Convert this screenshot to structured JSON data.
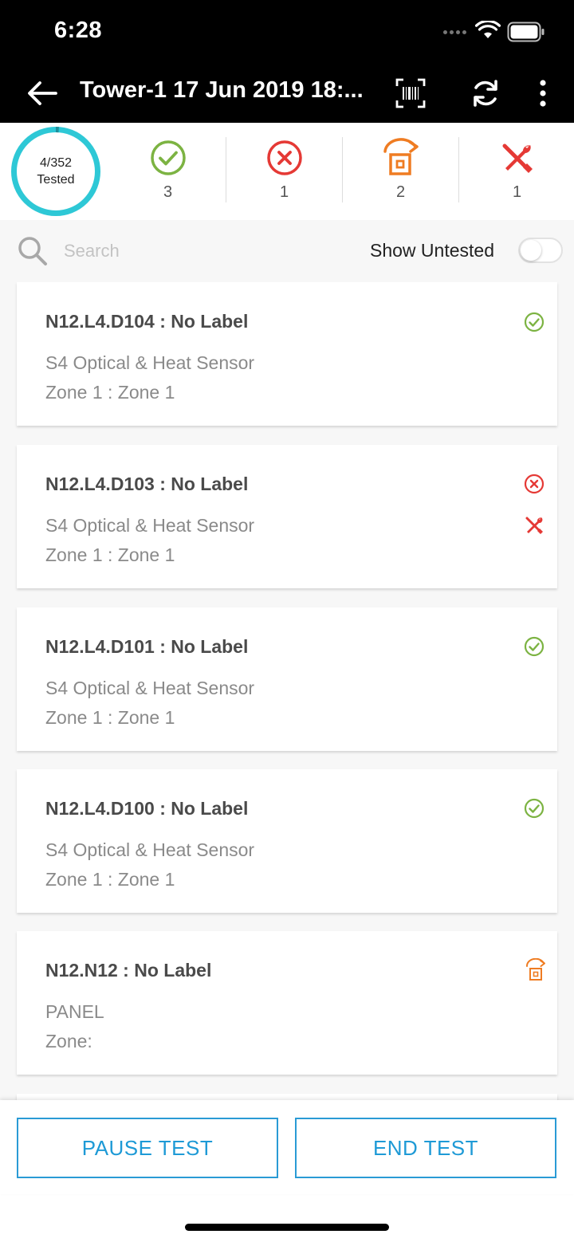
{
  "status_bar": {
    "time": "6:28"
  },
  "app_bar": {
    "title": "Tower-1 17 Jun 2019 18:..."
  },
  "summary": {
    "progress_label": "4/352",
    "progress_sub": "Tested",
    "progress_fraction": 0.0114,
    "stats": [
      {
        "icon": "check-circle-icon",
        "count": "3",
        "color": "#7cb342"
      },
      {
        "icon": "x-circle-icon",
        "count": "1",
        "color": "#e53935"
      },
      {
        "icon": "skip-icon",
        "count": "2",
        "color": "#ef7c22"
      },
      {
        "icon": "wrench-icon",
        "count": "1",
        "color": "#e53935"
      }
    ],
    "accent": "#2ec8d6"
  },
  "search": {
    "placeholder": "Search",
    "toggle_label": "Show Untested",
    "toggle_on": false
  },
  "devices": [
    {
      "name": "N12.L4.D104 : No Label",
      "type": "S4 Optical & Heat Sensor",
      "zone": "Zone 1 : Zone 1",
      "status": "passed"
    },
    {
      "name": "N12.L4.D103 : No Label",
      "type": "S4 Optical & Heat Sensor",
      "zone": "Zone 1 : Zone 1",
      "status": "failed-fault"
    },
    {
      "name": "N12.L4.D101 : No Label",
      "type": "S4 Optical & Heat Sensor",
      "zone": "Zone 1 : Zone 1",
      "status": "passed"
    },
    {
      "name": "N12.L4.D100 : No Label",
      "type": "S4 Optical & Heat Sensor",
      "zone": "Zone 1 : Zone 1",
      "status": "passed"
    },
    {
      "name": "N12.N12 : No Label",
      "type": "PANEL",
      "zone": "Zone:",
      "status": "skipped"
    }
  ],
  "actions": {
    "pause_label": "PAUSE TEST",
    "end_label": "END TEST"
  }
}
